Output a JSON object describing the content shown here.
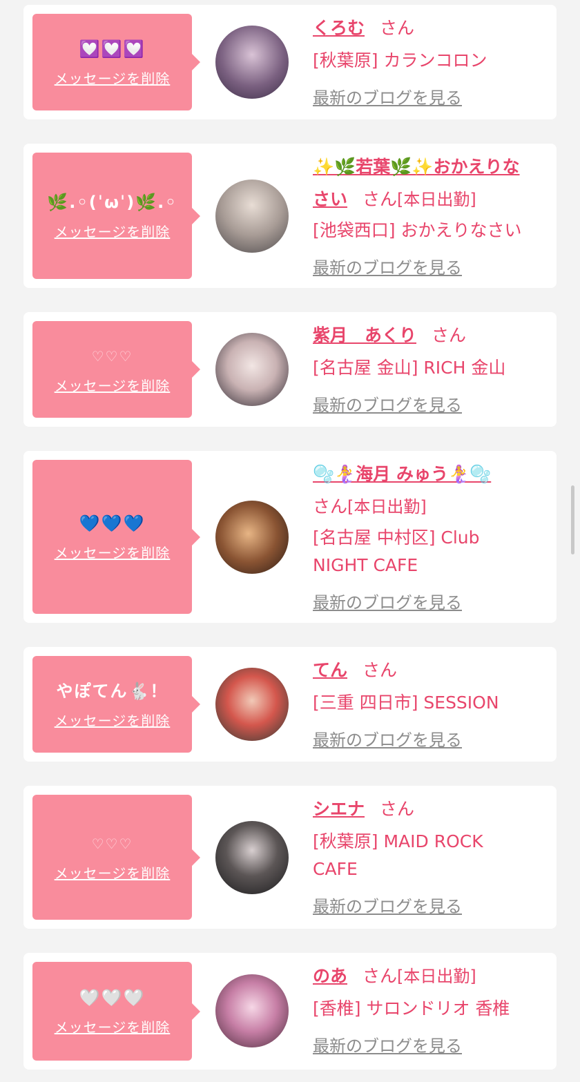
{
  "common": {
    "san": "さん",
    "delete_label": "メッセージを削除",
    "blog_label": "最新のブログを見る"
  },
  "cards": [
    {
      "message": "💟💟💟",
      "name": "くろむ",
      "today": "",
      "shop": "[秋葉原] カランコロン"
    },
    {
      "message": "🌿.◦(ˈωˈ)🌿.◦",
      "name_line1": "✨🌿若葉🌿✨おかえりな",
      "name_line2": "さい",
      "today": "[本日出勤]",
      "shop": "[池袋西口] おかえりなさい"
    },
    {
      "message": "♡♡♡",
      "name": "紫月　あくり",
      "today": "",
      "shop": "[名古屋 金山] RICH 金山"
    },
    {
      "message": "💙💙💙",
      "name": "🫧🧜‍♀️海月 みゅう🧜‍♀️🫧",
      "today": "[本日出勤]",
      "shop_line1": "[名古屋 中村区] Club",
      "shop_line2": "NIGHT CAFE"
    },
    {
      "message": "やぽてん🐇！",
      "name": "てん",
      "today": "",
      "shop": "[三重 四日市] SESSION"
    },
    {
      "message": "♡♡♡",
      "name": "シエナ",
      "today": "",
      "shop_line1": "[秋葉原] MAID ROCK",
      "shop_line2": "CAFE"
    },
    {
      "message": "🤍🤍🤍",
      "name": "のあ",
      "today": "[本日出勤]",
      "shop": "[香椎] サロンドリオ 香椎"
    }
  ],
  "colors": {
    "accent": "#e8456b",
    "bubble": "#f98c9c",
    "link_gray": "#8c8c8c",
    "background": "#f3f3f3"
  },
  "avatars": [
    "purple-hair",
    "blonde",
    "bunny-cover",
    "gold-photo",
    "red-hair",
    "black-hair",
    "pink-bunny"
  ]
}
